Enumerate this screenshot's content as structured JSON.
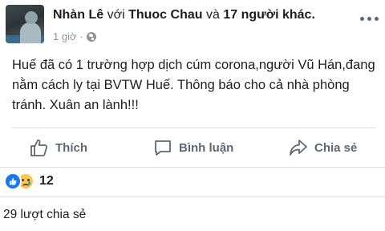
{
  "post": {
    "author": "Nhàn Lê",
    "with_word": "với",
    "tagged_person": "Thuoc Chau",
    "and_word": "và",
    "others": "17 người khác.",
    "time": "1 giờ",
    "dot": "·",
    "text_lines": [
      "Huế đã có 1 trường hợp dịch cúm corona,người Vũ Hán,đang",
      "nằm cách ly tại BVTW Huế. Thông báo cho cả nhà phòng",
      "tránh. Xuân an lành!!!"
    ]
  },
  "actions": {
    "like": "Thích",
    "comment": "Bình luận",
    "share": "Chia sẻ"
  },
  "reactions": {
    "count": "12"
  },
  "shares": {
    "label": "29 lượt chia sẻ"
  },
  "colors": {
    "icon_gray": "#606770",
    "meta_gray": "#90949c",
    "like_blue": "#1877f2",
    "sad_yellow": "#f7c94a"
  }
}
